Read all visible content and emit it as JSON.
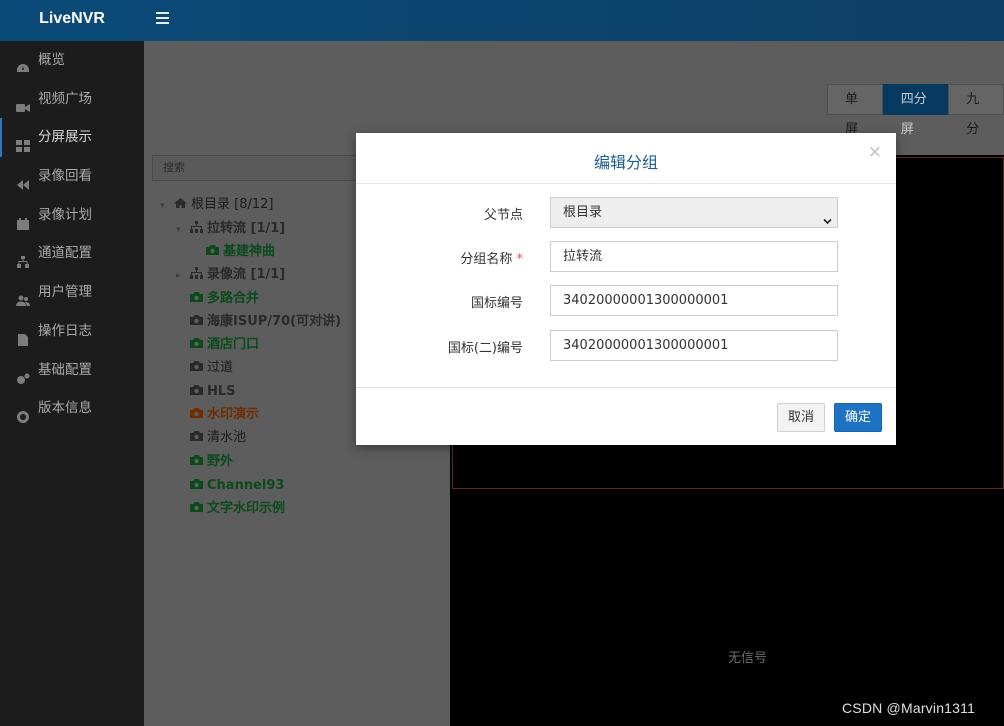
{
  "app": {
    "brand": "LiveNVR"
  },
  "sidebar": {
    "items": [
      {
        "label": "概览",
        "icon": "dashboard-icon"
      },
      {
        "label": "视频广场",
        "icon": "video-camera-icon"
      },
      {
        "label": "分屏展示",
        "icon": "grid-icon",
        "active": true
      },
      {
        "label": "录像回看",
        "icon": "rewind-icon"
      },
      {
        "label": "录像计划",
        "icon": "calendar-icon"
      },
      {
        "label": "通道配置",
        "icon": "sitemap-icon"
      },
      {
        "label": "用户管理",
        "icon": "users-icon"
      },
      {
        "label": "操作日志",
        "icon": "file-icon"
      },
      {
        "label": "基础配置",
        "icon": "gears-icon"
      },
      {
        "label": "版本信息",
        "icon": "life-ring-icon"
      }
    ]
  },
  "screen_tabs": [
    {
      "label": "单屏"
    },
    {
      "label": "四分屏",
      "active": true
    },
    {
      "label": "九分"
    }
  ],
  "search": {
    "placeholder": "搜索"
  },
  "tree": {
    "root": "根目录 [8/12]",
    "nodes": [
      {
        "label": "拉转流 [1/1]"
      },
      {
        "label": "基建神曲"
      },
      {
        "label": "录像流 [1/1]"
      },
      {
        "label": "多路合并"
      },
      {
        "label": "海康ISUP/70(可对讲)"
      },
      {
        "label": "酒店门口"
      },
      {
        "label": "过道"
      },
      {
        "label": "HLS"
      },
      {
        "label": "水印演示"
      },
      {
        "label": "清水池"
      },
      {
        "label": "野外"
      },
      {
        "label": "Channel93"
      },
      {
        "label": "文字水印示例"
      }
    ]
  },
  "video": {
    "no_signal": "无信号"
  },
  "modal": {
    "title": "编辑分组",
    "close": "×",
    "fields": {
      "parent": {
        "label": "父节点",
        "value": "根目录"
      },
      "name": {
        "label": "分组名称",
        "required_mark": "*",
        "value": "拉转流"
      },
      "gb_code": {
        "label": "国标编号",
        "value": "34020000001300000001"
      },
      "gb2_code": {
        "label": "国标(二)编号",
        "value": "34020000001300000001"
      }
    },
    "cancel": "取消",
    "ok": "确定"
  },
  "watermark": "CSDN @Marvin1311",
  "colors": {
    "header": "#0b4a78",
    "sidebar": "#1c1c1c",
    "primary_button": "#1e72c2",
    "modal_title": "#1f5d93"
  }
}
